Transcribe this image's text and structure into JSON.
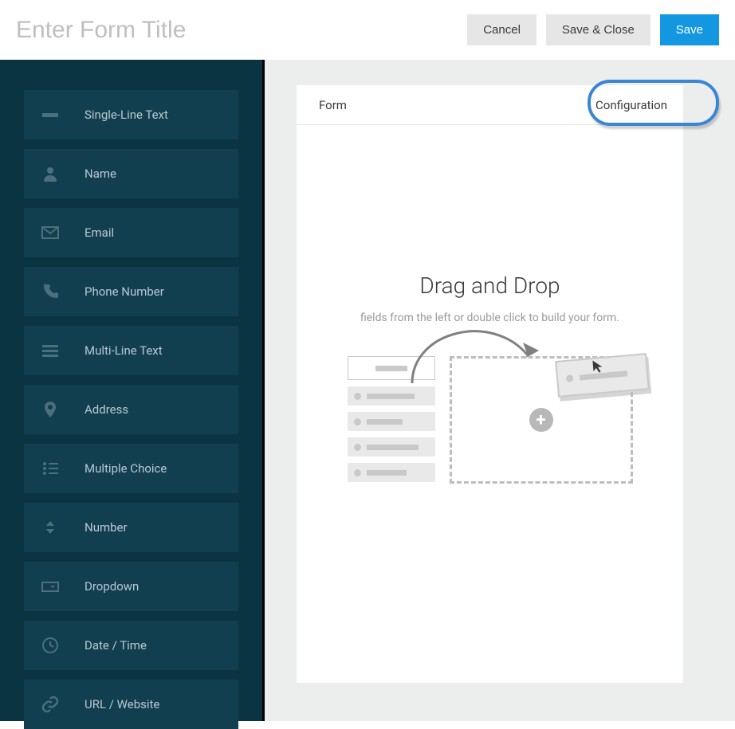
{
  "header": {
    "title_placeholder": "Enter Form Title",
    "title_value": "",
    "cancel_label": "Cancel",
    "save_close_label": "Save & Close",
    "save_label": "Save"
  },
  "sidebar": {
    "items": [
      {
        "icon": "text-short-icon",
        "label": "Single-Line Text"
      },
      {
        "icon": "person-icon",
        "label": "Name"
      },
      {
        "icon": "envelope-icon",
        "label": "Email"
      },
      {
        "icon": "phone-icon",
        "label": "Phone Number"
      },
      {
        "icon": "text-lines-icon",
        "label": "Multi-Line Text"
      },
      {
        "icon": "pin-icon",
        "label": "Address"
      },
      {
        "icon": "radio-list-icon",
        "label": "Multiple Choice"
      },
      {
        "icon": "sort-icon",
        "label": "Number"
      },
      {
        "icon": "dropdown-icon",
        "label": "Dropdown"
      },
      {
        "icon": "clock-icon",
        "label": "Date / Time"
      },
      {
        "icon": "link-icon",
        "label": "URL / Website"
      }
    ]
  },
  "tabs": {
    "form_label": "Form",
    "config_label": "Configuration"
  },
  "dropzone": {
    "title": "Drag and Drop",
    "subtitle": "fields from the left or double click to build your form."
  }
}
